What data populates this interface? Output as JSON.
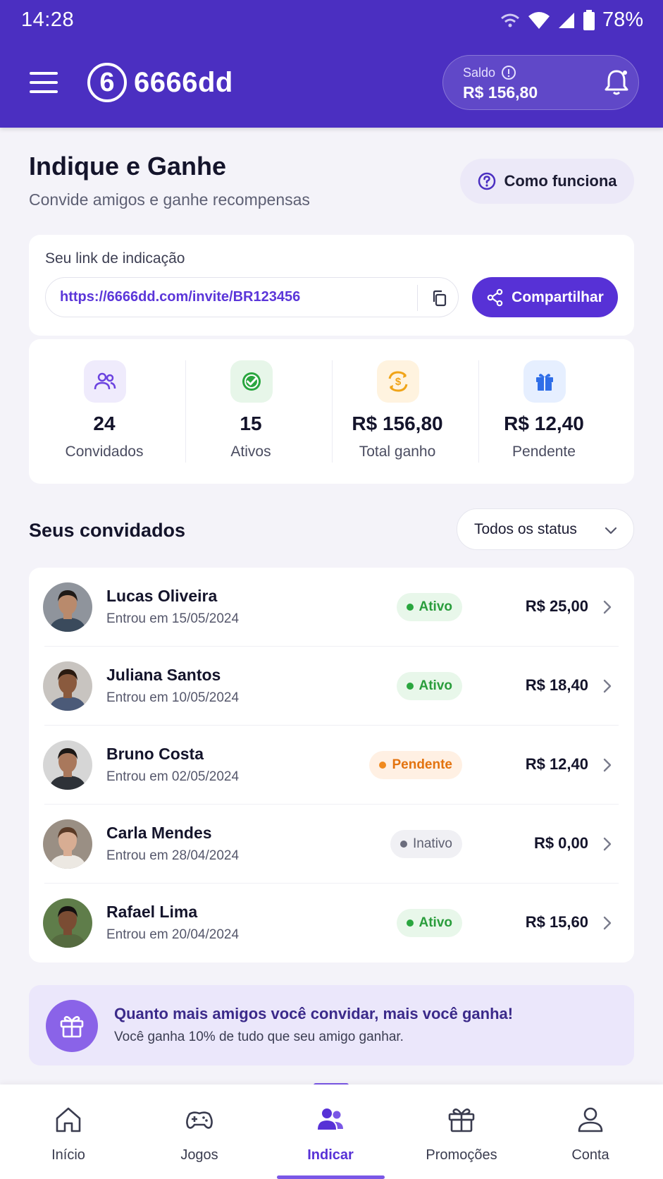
{
  "status_bar": {
    "time": "14:28",
    "battery": "78%"
  },
  "header": {
    "logo_mark": "6",
    "app_name": "6666dd",
    "balance_label": "Saldo",
    "balance_value": "R$ 156,80"
  },
  "page": {
    "title": "Indique e Ganhe",
    "subtitle": "Convide amigos e ganhe recompensas",
    "how_it_works": "Como funciona"
  },
  "referral": {
    "label": "Seu link de indicação",
    "url": "https://6666dd.com/invite/BR123456",
    "share_label": "Compartilhar"
  },
  "stats": [
    {
      "value": "24",
      "label": "Convidados",
      "icon": "users-icon",
      "color": "#6b43e0",
      "bg": "#efebfc"
    },
    {
      "value": "15",
      "label": "Ativos",
      "icon": "check-circle-icon",
      "color": "#2aa63f",
      "bg": "#e7f6e9"
    },
    {
      "value": "R$ 156,80",
      "label": "Total ganho",
      "icon": "coin-swap-icon",
      "color": "#f0a418",
      "bg": "#fff3df"
    },
    {
      "value": "R$ 12,40",
      "label": "Pendente",
      "icon": "gift-icon",
      "color": "#2f6ee8",
      "bg": "#e6efff"
    }
  ],
  "invitees_section": {
    "title": "Seus convidados",
    "filter_value": "Todos os status"
  },
  "invitees": [
    {
      "name": "Lucas Oliveira",
      "date": "Entrou em 15/05/2024",
      "status": "Ativo",
      "status_kind": "ativo",
      "amount": "R$ 25,00",
      "skin": "#b98a6c",
      "hair": "#1f1a17",
      "shirt": "#3a4a5c",
      "bg": "#8f949c"
    },
    {
      "name": "Juliana Santos",
      "date": "Entrou em 10/05/2024",
      "status": "Ativo",
      "status_kind": "ativo",
      "amount": "R$ 18,40",
      "skin": "#8a5a3e",
      "hair": "#2a1a10",
      "shirt": "#4b5a78",
      "bg": "#c8c4c0"
    },
    {
      "name": "Bruno Costa",
      "date": "Entrou em 02/05/2024",
      "status": "Pendente",
      "status_kind": "pendente",
      "amount": "R$ 12,40",
      "skin": "#a9785c",
      "hair": "#1c1816",
      "shirt": "#2e3238",
      "bg": "#d6d6d6"
    },
    {
      "name": "Carla Mendes",
      "date": "Entrou em 28/04/2024",
      "status": "Inativo",
      "status_kind": "inativo",
      "amount": "R$ 0,00",
      "skin": "#d8ad93",
      "hair": "#5a3a26",
      "shirt": "#ece8e2",
      "bg": "#9a8f84"
    },
    {
      "name": "Rafael Lima",
      "date": "Entrou em 20/04/2024",
      "status": "Ativo",
      "status_kind": "ativo",
      "amount": "R$ 15,60",
      "skin": "#7a4c33",
      "hair": "#141010",
      "shirt": "#556a3f",
      "bg": "#5f7d4a"
    }
  ],
  "promo": {
    "title": "Quanto mais amigos você convidar, mais você ganha!",
    "subtitle": "Você ganha 10% de tudo que seu amigo ganhar."
  },
  "bottom_nav": [
    {
      "label": "Início",
      "icon": "home-icon",
      "active": false
    },
    {
      "label": "Jogos",
      "icon": "gamepad-icon",
      "active": false
    },
    {
      "label": "Indicar",
      "icon": "users-icon",
      "active": true
    },
    {
      "label": "Promoções",
      "icon": "gift-icon",
      "active": false
    },
    {
      "label": "Conta",
      "icon": "user-icon",
      "active": false
    }
  ],
  "colors": {
    "brand": "#4b2fc1",
    "accent": "#5731d6",
    "page_bg": "#f4f3f9"
  }
}
